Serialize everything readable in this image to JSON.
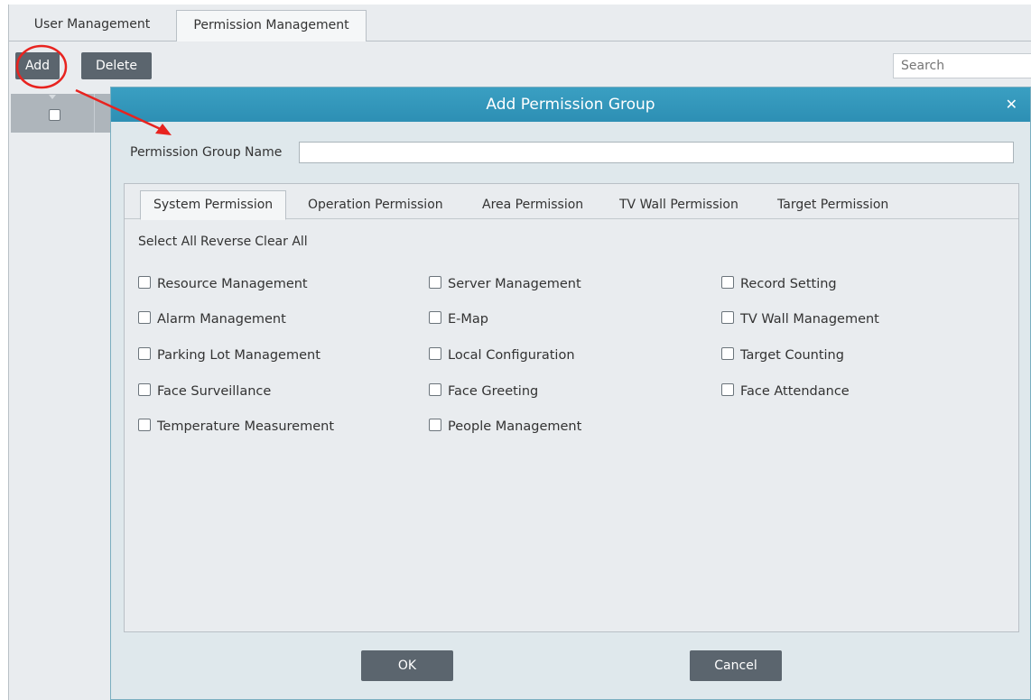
{
  "tabs": [
    "User Management",
    "Permission Management"
  ],
  "toolbar": {
    "add_label": "Add",
    "delete_label": "Delete",
    "search_placeholder": "Search"
  },
  "dialog": {
    "title": "Add Permission Group",
    "close_icon": "close-icon",
    "group_name_label": "Permission Group Name",
    "group_name_value": "",
    "tabs": [
      "System Permission",
      "Operation Permission",
      "Area Permission",
      "TV Wall Permission",
      "Target Permission"
    ],
    "active_tab": "System Permission",
    "select_links": [
      "Select All",
      "Reverse",
      "Clear All"
    ],
    "permissions": [
      "Resource Management",
      "Server Management",
      "Record Setting",
      "Alarm Management",
      "E-Map",
      "TV Wall Management",
      "Parking Lot Management",
      "Local Configuration",
      "Target Counting",
      "Face Surveillance",
      "Face Greeting",
      "Face Attendance",
      "Temperature Measurement",
      "People Management"
    ],
    "ok_label": "OK",
    "cancel_label": "Cancel"
  },
  "colors": {
    "title_bar": "#3a9fc2",
    "button": "#5b656e",
    "annotation": "#e8231f"
  }
}
